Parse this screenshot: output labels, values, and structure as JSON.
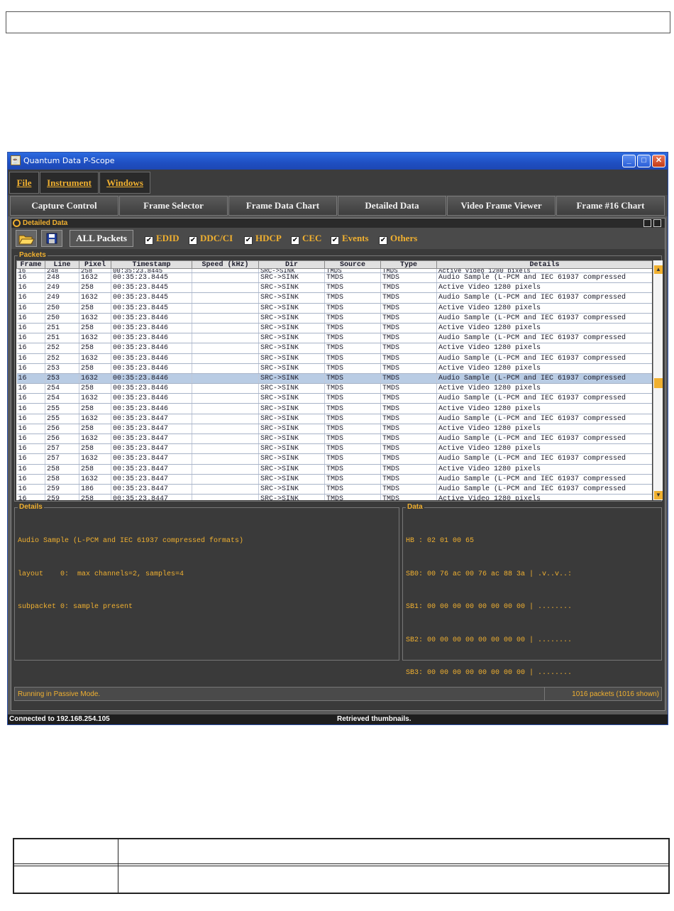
{
  "window": {
    "title": "Quantum Data P-Scope",
    "minimize": "_",
    "maximize": "□",
    "close": "✕"
  },
  "menu": [
    "File",
    "Instrument",
    "Windows"
  ],
  "tabs": [
    "Capture Control",
    "Frame Selector",
    "Frame Data Chart",
    "Detailed Data",
    "Video Frame Viewer",
    "Frame #16 Chart"
  ],
  "panel": {
    "title": "Detailed Data"
  },
  "toolbar": {
    "open_icon": "folder-open-icon",
    "save_icon": "floppy-save-icon",
    "all_packets": "ALL Packets",
    "filters": [
      {
        "label": "EDID",
        "checked": true
      },
      {
        "label": "DDC/CI",
        "checked": true
      },
      {
        "label": "HDCP",
        "checked": true
      },
      {
        "label": "CEC",
        "checked": true
      },
      {
        "label": "Events",
        "checked": true
      },
      {
        "label": "Others",
        "checked": true
      }
    ]
  },
  "packets": {
    "label": "Packets",
    "columns": [
      "Frame",
      "Line",
      "Pixel",
      "Timestamp",
      "Speed (kHz)",
      "Dir",
      "Source",
      "Type",
      "Details"
    ],
    "partial_row": [
      "16",
      "248",
      "258",
      "00:35:23.8445",
      "",
      "SRC->SINK",
      "TMDS",
      "TMDS",
      "Active Video 1280 pixels"
    ],
    "rows": [
      [
        "16",
        "248",
        "1632",
        "00:35:23.8445",
        "",
        "SRC->SINK",
        "TMDS",
        "TMDS",
        "Audio Sample (L-PCM and IEC 61937 compressed"
      ],
      [
        "16",
        "249",
        "258",
        "00:35:23.8445",
        "",
        "SRC->SINK",
        "TMDS",
        "TMDS",
        "Active Video 1280 pixels"
      ],
      [
        "16",
        "249",
        "1632",
        "00:35:23.8445",
        "",
        "SRC->SINK",
        "TMDS",
        "TMDS",
        "Audio Sample (L-PCM and IEC 61937 compressed"
      ],
      [
        "16",
        "250",
        "258",
        "00:35:23.8445",
        "",
        "SRC->SINK",
        "TMDS",
        "TMDS",
        "Active Video 1280 pixels"
      ],
      [
        "16",
        "250",
        "1632",
        "00:35:23.8446",
        "",
        "SRC->SINK",
        "TMDS",
        "TMDS",
        "Audio Sample (L-PCM and IEC 61937 compressed"
      ],
      [
        "16",
        "251",
        "258",
        "00:35:23.8446",
        "",
        "SRC->SINK",
        "TMDS",
        "TMDS",
        "Active Video 1280 pixels"
      ],
      [
        "16",
        "251",
        "1632",
        "00:35:23.8446",
        "",
        "SRC->SINK",
        "TMDS",
        "TMDS",
        "Audio Sample (L-PCM and IEC 61937 compressed"
      ],
      [
        "16",
        "252",
        "258",
        "00:35:23.8446",
        "",
        "SRC->SINK",
        "TMDS",
        "TMDS",
        "Active Video 1280 pixels"
      ],
      [
        "16",
        "252",
        "1632",
        "00:35:23.8446",
        "",
        "SRC->SINK",
        "TMDS",
        "TMDS",
        "Audio Sample (L-PCM and IEC 61937 compressed"
      ],
      [
        "16",
        "253",
        "258",
        "00:35:23.8446",
        "",
        "SRC->SINK",
        "TMDS",
        "TMDS",
        "Active Video 1280 pixels"
      ],
      [
        "16",
        "253",
        "1632",
        "00:35:23.8446",
        "",
        "SRC->SINK",
        "TMDS",
        "TMDS",
        "Audio Sample (L-PCM and IEC 61937 compressed"
      ],
      [
        "16",
        "254",
        "258",
        "00:35:23.8446",
        "",
        "SRC->SINK",
        "TMDS",
        "TMDS",
        "Active Video 1280 pixels"
      ],
      [
        "16",
        "254",
        "1632",
        "00:35:23.8446",
        "",
        "SRC->SINK",
        "TMDS",
        "TMDS",
        "Audio Sample (L-PCM and IEC 61937 compressed"
      ],
      [
        "16",
        "255",
        "258",
        "00:35:23.8446",
        "",
        "SRC->SINK",
        "TMDS",
        "TMDS",
        "Active Video 1280 pixels"
      ],
      [
        "16",
        "255",
        "1632",
        "00:35:23.8447",
        "",
        "SRC->SINK",
        "TMDS",
        "TMDS",
        "Audio Sample (L-PCM and IEC 61937 compressed"
      ],
      [
        "16",
        "256",
        "258",
        "00:35:23.8447",
        "",
        "SRC->SINK",
        "TMDS",
        "TMDS",
        "Active Video 1280 pixels"
      ],
      [
        "16",
        "256",
        "1632",
        "00:35:23.8447",
        "",
        "SRC->SINK",
        "TMDS",
        "TMDS",
        "Audio Sample (L-PCM and IEC 61937 compressed"
      ],
      [
        "16",
        "257",
        "258",
        "00:35:23.8447",
        "",
        "SRC->SINK",
        "TMDS",
        "TMDS",
        "Active Video 1280 pixels"
      ],
      [
        "16",
        "257",
        "1632",
        "00:35:23.8447",
        "",
        "SRC->SINK",
        "TMDS",
        "TMDS",
        "Audio Sample (L-PCM and IEC 61937 compressed"
      ],
      [
        "16",
        "258",
        "258",
        "00:35:23.8447",
        "",
        "SRC->SINK",
        "TMDS",
        "TMDS",
        "Active Video 1280 pixels"
      ],
      [
        "16",
        "258",
        "1632",
        "00:35:23.8447",
        "",
        "SRC->SINK",
        "TMDS",
        "TMDS",
        "Audio Sample (L-PCM and IEC 61937 compressed"
      ],
      [
        "16",
        "259",
        "186",
        "00:35:23.8447",
        "",
        "SRC->SINK",
        "TMDS",
        "TMDS",
        "Audio Sample (L-PCM and IEC 61937 compressed"
      ],
      [
        "16",
        "259",
        "258",
        "00:35:23.8447",
        "",
        "SRC->SINK",
        "TMDS",
        "TMDS",
        "Active Video 1280 pixels"
      ]
    ],
    "selected_index": 10
  },
  "details": {
    "label": "Details",
    "lines": [
      "Audio Sample (L-PCM and IEC 61937 compressed formats)",
      "layout    0:  max channels=2, samples=4",
      "subpacket 0: sample present"
    ]
  },
  "data": {
    "label": "Data",
    "lines": [
      "HB : 02 01 00 65",
      "SB0: 00 76 ac 00 76 ac 88 3a | .v..v..:",
      "SB1: 00 00 00 00 00 00 00 00 | ........",
      "SB2: 00 00 00 00 00 00 00 00 | ........",
      "SB3: 00 00 00 00 00 00 00 00 | ........"
    ]
  },
  "status": {
    "mode": "Running in Passive Mode.",
    "count": "1016 packets (1016 shown)"
  },
  "connection": {
    "left": "Connected to 192.168.254.105",
    "middle": "Retrieved thumbnails."
  },
  "colors": {
    "accent": "#f0b030",
    "titlebar": "#2c6be0",
    "selected_row": "#b9cce4"
  }
}
